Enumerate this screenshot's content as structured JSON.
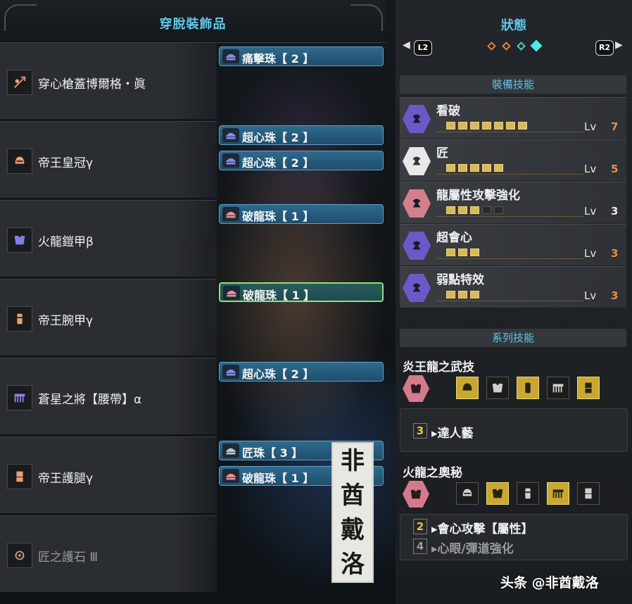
{
  "left_panel": {
    "title": "穿脫裝飾品",
    "equipment": [
      {
        "name": "穿心槍蓋博爾格・眞",
        "icon": "lance-weapon-icon",
        "decorations": [
          {
            "label": "痛擊珠【 2 】",
            "icon": "decoration-jewel-icon"
          }
        ]
      },
      {
        "name": "帝王皇冠γ",
        "icon": "helm-icon",
        "decorations": [
          {
            "label": "超心珠【 2 】",
            "icon": "decoration-jewel-icon"
          },
          {
            "label": "超心珠【 2 】",
            "icon": "decoration-jewel-icon"
          }
        ]
      },
      {
        "name": "火龍鎧甲β",
        "icon": "chest-armor-icon",
        "decorations": [
          {
            "label": "破龍珠【 1 】",
            "icon": "decoration-jewel-icon"
          }
        ]
      },
      {
        "name": "帝王腕甲γ",
        "icon": "arm-armor-icon",
        "decorations": [
          {
            "label": "破龍珠【 1 】",
            "icon": "decoration-jewel-icon",
            "selected": true
          }
        ]
      },
      {
        "name": "蒼星之將【腰帶】α",
        "icon": "waist-armor-icon",
        "decorations": [
          {
            "label": "超心珠【 2 】",
            "icon": "decoration-jewel-icon"
          }
        ]
      },
      {
        "name": "帝王護腿γ",
        "icon": "leg-armor-icon",
        "decorations": [
          {
            "label": "匠珠【 3 】",
            "icon": "decoration-jewel-icon"
          },
          {
            "label": "破龍珠【 1 】",
            "icon": "decoration-jewel-icon"
          }
        ]
      },
      {
        "name": "匠之護石 Ⅲ",
        "icon": "charm-icon",
        "decorations": []
      }
    ]
  },
  "right_panel": {
    "title": "狀態",
    "left_shoulder": "L2",
    "right_shoulder": "R2",
    "page_count": 4,
    "active_page": 4,
    "equipped_skills_title": "裝備技能",
    "skills": [
      {
        "name": "看破",
        "level_label": "Lv",
        "level": "7",
        "max": 7,
        "color": "purple",
        "level_color": "#e8923a"
      },
      {
        "name": "匠",
        "level_label": "Lv",
        "level": "5",
        "max": 5,
        "color": "white",
        "level_color": "#e8923a"
      },
      {
        "name": "龍屬性攻擊強化",
        "level_label": "Lv",
        "level": "3",
        "max": 5,
        "color": "pink",
        "level_color": "#e8e8e8"
      },
      {
        "name": "超會心",
        "level_label": "Lv",
        "level": "3",
        "max": 3,
        "color": "purple",
        "level_color": "#e8923a"
      },
      {
        "name": "弱點特效",
        "level_label": "Lv",
        "level": "3",
        "max": 3,
        "color": "purple",
        "level_color": "#e8923a"
      }
    ],
    "set_skills_title": "系列技能",
    "set_skills": [
      {
        "name": "炎王龍之武技",
        "slots": [
          true,
          false,
          true,
          false,
          true
        ],
        "bonuses": [
          {
            "count": "3",
            "text": "達人藝",
            "active": true
          }
        ]
      },
      {
        "name": "火龍之奧秘",
        "slots": [
          false,
          true,
          false,
          true,
          false
        ],
        "bonuses": [
          {
            "count": "2",
            "text": "會心攻擊【屬性】",
            "active": true
          },
          {
            "count": "4",
            "text": "心眼/彈道強化",
            "active": false
          }
        ]
      }
    ]
  },
  "stamp_text": [
    "非",
    "酋",
    "戴",
    "洛"
  ],
  "watermark": "头条 @非酋戴洛"
}
